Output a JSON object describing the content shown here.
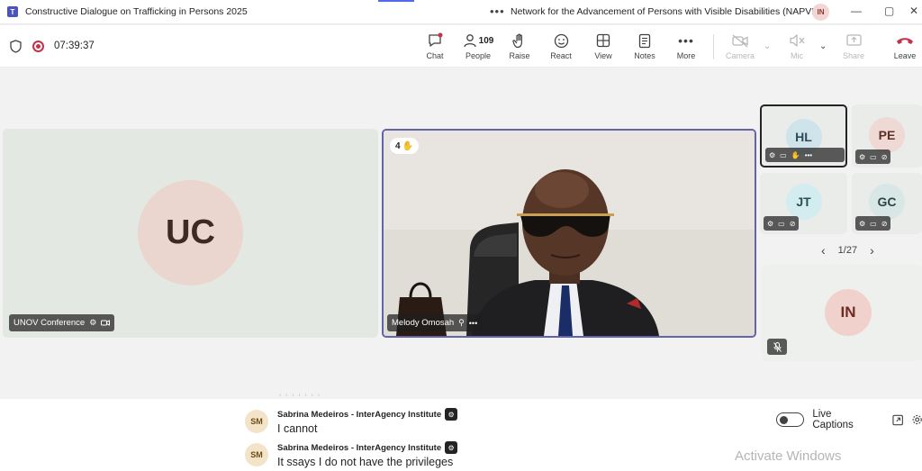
{
  "window": {
    "app_logo": "T",
    "title": "Constructive Dialogue on Trafficking in Persons 2025",
    "more": "•••",
    "org": "Network for the Advancement of Persons with Visible Disabilities (NAPVID)",
    "user_initials": "IN",
    "controls": {
      "minimize": "—",
      "restore": "▢",
      "close": "✕"
    }
  },
  "toolbar": {
    "timer": "07:39:37",
    "buttons": {
      "chat": "Chat",
      "people": "People",
      "people_count": "109",
      "raise": "Raise",
      "react": "React",
      "view": "View",
      "notes": "Notes",
      "more": "More",
      "camera": "Camera",
      "mic": "Mic",
      "share": "Share",
      "leave": "Leave"
    },
    "icons": {
      "chat": "chat-icon",
      "people": "people-icon",
      "raise": "hand-icon",
      "react": "smile-icon",
      "view": "grid-icon",
      "notes": "notes-icon",
      "more": "more-icon",
      "camera": "camera-off-icon",
      "mic": "mic-off-icon",
      "share": "share-icon",
      "leave": "phone-icon"
    }
  },
  "stage": {
    "uc_tile": {
      "initials": "UC",
      "name": "UNOV Conference",
      "avatar_color": "#e9d5cf"
    },
    "video_tile": {
      "name": "Melody Omosah",
      "raise_order": "4",
      "raise_emoji": "✋"
    },
    "gallery": [
      {
        "initials": "HL",
        "color": "#cfe3ea"
      },
      {
        "initials": "PE",
        "color": "#efd9d5"
      },
      {
        "initials": "JT",
        "color": "#d3ecef"
      },
      {
        "initials": "GC",
        "color": "#d9e6e6"
      }
    ],
    "pager": {
      "label": "1/27",
      "prev": "‹",
      "next": "›"
    },
    "self_tile": {
      "initials": "IN",
      "color": "#f1d1cc"
    }
  },
  "captions": {
    "entries": [
      {
        "initials": "SM",
        "speaker": "Sabrina Medeiros - InterAgency Institute",
        "text": "I cannot"
      },
      {
        "initials": "SM",
        "speaker": "Sabrina Medeiros - InterAgency Institute",
        "text": "It ssays I do not have the privileges"
      }
    ],
    "live_captions_label": "Live Captions",
    "watermark": "Activate Windows"
  }
}
